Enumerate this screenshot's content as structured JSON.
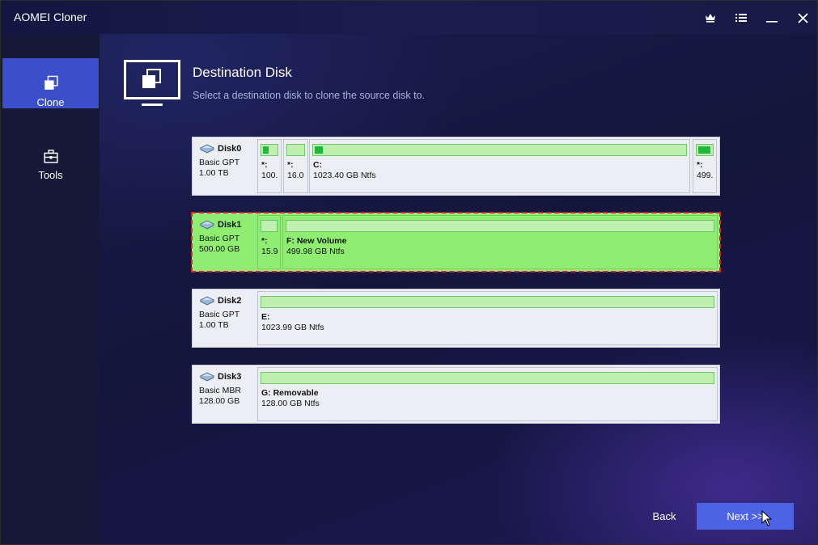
{
  "window": {
    "title": "AOMEI Cloner"
  },
  "titlebar_icons": [
    "crown-icon",
    "menu-list-icon",
    "minimize-icon",
    "close-icon"
  ],
  "sidebar": {
    "items": [
      {
        "label": "Clone",
        "icon": "clone-icon",
        "active": true
      },
      {
        "label": "Tools",
        "icon": "toolbox-icon",
        "active": false
      }
    ]
  },
  "header": {
    "title": "Destination Disk",
    "subtitle": "Select a destination disk to clone the source disk to."
  },
  "disks": [
    {
      "name": "Disk0",
      "type": "Basic GPT",
      "size": "1.00 TB",
      "selected": false,
      "partitions": [
        {
          "label": "*:",
          "detail": "100.",
          "used": 0.35
        },
        {
          "label": "*:",
          "detail": "16.0",
          "used": 0.0
        },
        {
          "label": "C:",
          "detail": "1023.40 GB Ntfs",
          "used": 0.02
        },
        {
          "label": "*:",
          "detail": "499.",
          "used": 0.75
        }
      ]
    },
    {
      "name": "Disk1",
      "type": "Basic GPT",
      "size": "500.00 GB",
      "selected": true,
      "partitions": [
        {
          "label": "*:",
          "detail": "15.9",
          "used": 0.0
        },
        {
          "label": "F: New Volume",
          "detail": "499.98 GB Ntfs",
          "used": 0.0
        }
      ]
    },
    {
      "name": "Disk2",
      "type": "Basic GPT",
      "size": "1.00 TB",
      "selected": false,
      "partitions": [
        {
          "label": "E:",
          "detail": "1023.99 GB Ntfs",
          "used": 0.0
        }
      ]
    },
    {
      "name": "Disk3",
      "type": "Basic MBR",
      "size": "128.00 GB",
      "selected": false,
      "partitions": [
        {
          "label": "G: Removable",
          "detail": "128.00 GB Ntfs",
          "used": 0.0
        }
      ]
    }
  ],
  "footer": {
    "back_label": "Back",
    "next_label": "Next >>"
  },
  "colors": {
    "accent": "#4d63e6",
    "sidebar_active": "#3a4fc9",
    "selected_disk": "#8fee72",
    "selection_outline": "#e0201e",
    "used_fill": "#1db83c"
  }
}
